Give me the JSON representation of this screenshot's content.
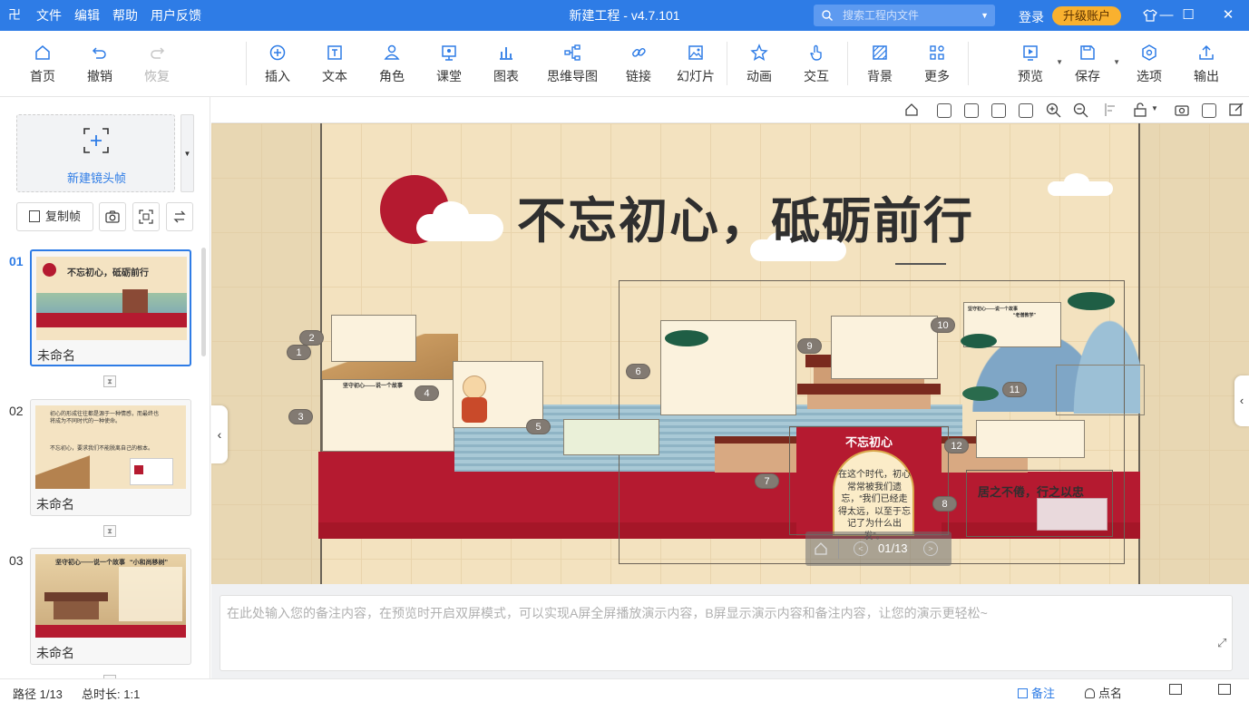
{
  "app": {
    "menu": [
      "文件",
      "编辑",
      "帮助",
      "用户反馈"
    ],
    "title": "新建工程 - v4.7.101",
    "search_placeholder": "搜索工程内文件",
    "login": "登录",
    "upgrade": "升级账户"
  },
  "toolbar": {
    "home": "首页",
    "undo": "撤销",
    "redo": "恢复",
    "insert": "插入",
    "text": "文本",
    "role": "角色",
    "class": "课堂",
    "chart": "图表",
    "mindmap": "思维导图",
    "link": "链接",
    "slide": "幻灯片",
    "animation": "动画",
    "interact": "交互",
    "background": "背景",
    "more": "更多",
    "preview": "预览",
    "save": "保存",
    "options": "选项",
    "export": "输出"
  },
  "left_panel": {
    "new_frame": "新建镜头帧",
    "copy_frame": "复制帧",
    "slides": [
      {
        "num": "01",
        "name": "未命名",
        "thumb_title": "不忘初心，砥砺前行"
      },
      {
        "num": "02",
        "name": "未命名",
        "thumb_text1": "初心的形成往往都是源于一种情感，而最终也将成为不同时代的一种使命。",
        "thumb_text2": "不忘初心，要求我们不能脱离自己的根本。"
      },
      {
        "num": "03",
        "name": "未命名",
        "thumb_title": "坚守初心——说一个故事",
        "thumb_title2": "“小和尚移树”"
      }
    ]
  },
  "stage": {
    "title": "不忘初心，砥砺前行",
    "badges": [
      "1",
      "2",
      "3",
      "4",
      "5",
      "6",
      "7",
      "8",
      "9",
      "10",
      "11",
      "12"
    ],
    "center_heading": "不忘初心",
    "center_text": "在这个时代，初心常常被我们遗忘，“我们已经走得太远，以至于忘记了为什么出发”。",
    "right_heading": "居之不倦，行之以忠",
    "box4_title": "坚守初心——说一个故事",
    "box10_title": "坚守初心——说一个故事",
    "box10_subtitle": "“老僧教学”"
  },
  "playbar": {
    "page": "01/13"
  },
  "notes": {
    "placeholder": "在此处输入您的备注内容，在预览时开启双屏模式，可以实现A屏全屏播放演示内容，B屏显示演示内容和备注内容，让您的演示更轻松~"
  },
  "status": {
    "path": "路径 1/13",
    "duration": "总时长: 1:1",
    "notes": "备注",
    "roll_call": "点名"
  },
  "colors": {
    "titlebar": "#2e7ce6",
    "accent": "#2e7ce6",
    "upgrade": "#f9b12f",
    "stage_bg": "#f3e2bf",
    "red": "#b51a30"
  }
}
